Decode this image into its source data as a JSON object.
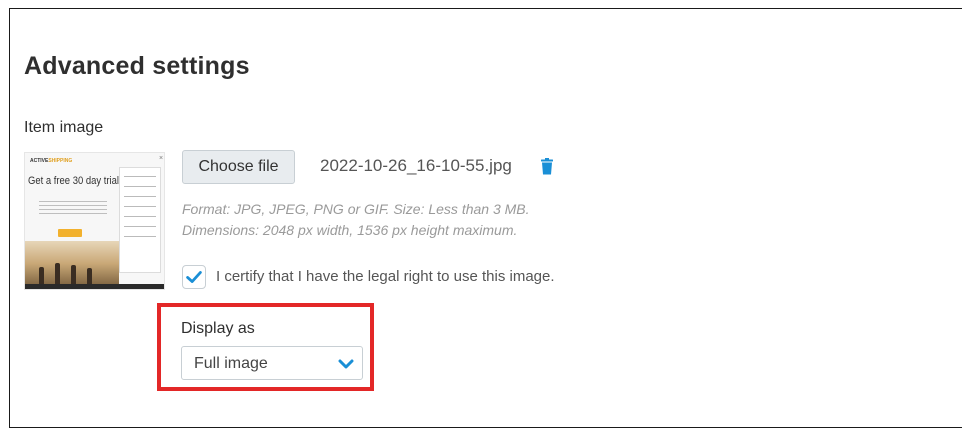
{
  "section": {
    "title": "Advanced settings"
  },
  "item_image": {
    "label": "Item image",
    "choose_button_label": "Choose file",
    "filename": "2022-10-26_16-10-55.jpg",
    "hint_format": "Format: JPG, JPEG, PNG or GIF. Size: Less than 3 MB.",
    "hint_dimensions": "Dimensions: 2048 px width, 1536 px height maximum.",
    "thumbnail": {
      "brand_part1": "ACTIVE",
      "brand_part2": "SHIPPING",
      "headline": "Get a free 30 day trial"
    }
  },
  "certify": {
    "checked": true,
    "label": "I certify that I have the legal right to use this image."
  },
  "display_as": {
    "label": "Display as",
    "selected": "Full image"
  },
  "colors": {
    "accent": "#1a8fd6",
    "highlight": "#e32727"
  },
  "icons": {
    "delete": "trash-icon",
    "check": "checkmark-icon",
    "dropdown": "chevron-down-icon"
  }
}
